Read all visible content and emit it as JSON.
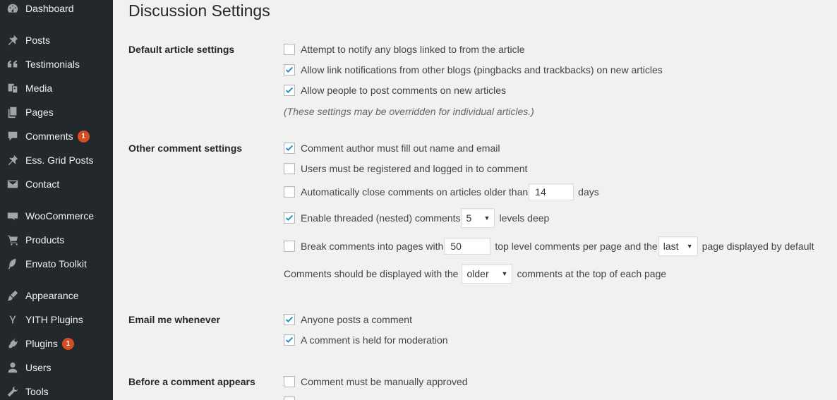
{
  "sidebar": {
    "items": [
      {
        "label": "Dashboard",
        "icon": "dashboard-icon"
      },
      {
        "label": "Posts",
        "icon": "pin-icon"
      },
      {
        "label": "Testimonials",
        "icon": "quote-icon"
      },
      {
        "label": "Media",
        "icon": "media-icon"
      },
      {
        "label": "Pages",
        "icon": "pages-icon"
      },
      {
        "label": "Comments",
        "icon": "comment-icon",
        "badge": "1"
      },
      {
        "label": "Ess. Grid Posts",
        "icon": "pin-icon"
      },
      {
        "label": "Contact",
        "icon": "envelope-icon"
      },
      {
        "label": "WooCommerce",
        "icon": "woo-icon"
      },
      {
        "label": "Products",
        "icon": "cart-icon"
      },
      {
        "label": "Envato Toolkit",
        "icon": "leaf-icon"
      },
      {
        "label": "Appearance",
        "icon": "brush-icon"
      },
      {
        "label": "YITH Plugins",
        "icon": "yith-icon"
      },
      {
        "label": "Plugins",
        "icon": "plug-icon",
        "badge": "1"
      },
      {
        "label": "Users",
        "icon": "user-icon"
      },
      {
        "label": "Tools",
        "icon": "wrench-icon"
      }
    ]
  },
  "page": {
    "title": "Discussion Settings"
  },
  "sections": {
    "default_article": {
      "label": "Default article settings",
      "notify_blogs": {
        "label": "Attempt to notify any blogs linked to from the article",
        "checked": false
      },
      "allow_pingbacks": {
        "label": "Allow link notifications from other blogs (pingbacks and trackbacks) on new articles",
        "checked": true
      },
      "allow_comments": {
        "label": "Allow people to post comments on new articles",
        "checked": true
      },
      "note": "(These settings may be overridden for individual articles.)"
    },
    "other_comment": {
      "label": "Other comment settings",
      "require_name_email": {
        "label": "Comment author must fill out name and email",
        "checked": true
      },
      "registered_only": {
        "label": "Users must be registered and logged in to comment",
        "checked": false
      },
      "auto_close": {
        "label": "Automatically close comments on articles older than",
        "checked": false,
        "value": "14",
        "suffix": "days"
      },
      "threaded": {
        "label": "Enable threaded (nested) comments",
        "checked": true,
        "value": "5",
        "suffix": "levels deep"
      },
      "paged": {
        "label": "Break comments into pages with",
        "checked": false,
        "value": "50",
        "middle": "top level comments per page and the",
        "select": "last",
        "suffix": "page displayed by default"
      },
      "order": {
        "prefix": "Comments should be displayed with the",
        "select": "older",
        "suffix": "comments at the top of each page"
      }
    },
    "email": {
      "label": "Email me whenever",
      "anyone_posts": {
        "label": "Anyone posts a comment",
        "checked": true
      },
      "held_moderation": {
        "label": "A comment is held for moderation",
        "checked": true
      }
    },
    "before_appears": {
      "label": "Before a comment appears",
      "manual_approval": {
        "label": "Comment must be manually approved",
        "checked": false
      }
    }
  }
}
